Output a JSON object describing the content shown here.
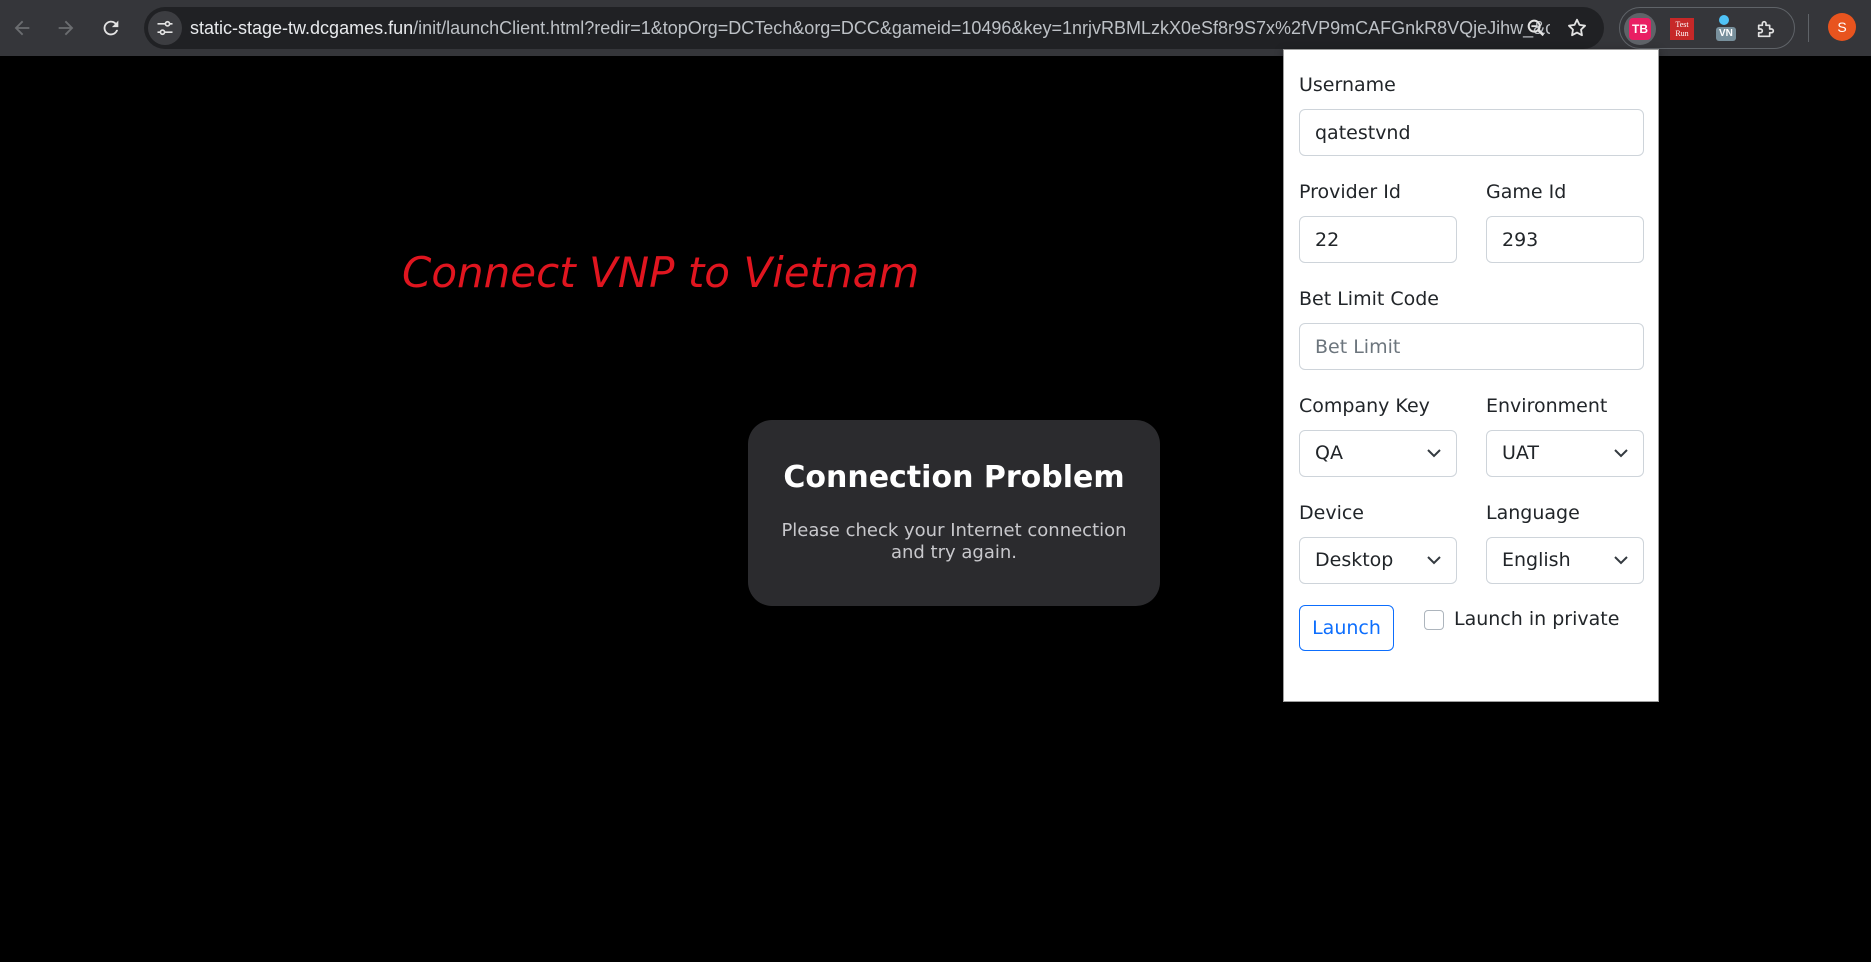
{
  "browser": {
    "url_domain": "static-stage-tw.dcgames.fun",
    "url_path": "/init/launchClient.html?redir=1&topOrg=DCTech&org=DCC&gameid=10496&key=1nrjvRBMLzkX0eSf8r9S7x%2fVP9mCAFGnkR8VQjeJihw_&c...",
    "extensions": {
      "tb_label": "TB",
      "testrun_label": "Test Run",
      "vn_badge": "VN"
    },
    "profile_initial": "S"
  },
  "page": {
    "heading": "Connect VNP to Vietnam",
    "modal": {
      "title": "Connection Problem",
      "message": "Please check your Internet connection and try again."
    }
  },
  "popup": {
    "username_label": "Username",
    "username_value": "qatestvnd",
    "provider_id_label": "Provider Id",
    "provider_id_value": "22",
    "game_id_label": "Game Id",
    "game_id_value": "293",
    "bet_limit_label": "Bet Limit Code",
    "bet_limit_placeholder": "Bet Limit",
    "company_key_label": "Company Key",
    "company_key_value": "QA",
    "environment_label": "Environment",
    "environment_value": "UAT",
    "device_label": "Device",
    "device_value": "Desktop",
    "language_label": "Language",
    "language_value": "English",
    "launch_label": "Launch",
    "private_label": "Launch in private"
  },
  "colors": {
    "heading": "#e0151f",
    "accent": "#0d6efd",
    "modal_bg": "#2b2b2e"
  }
}
